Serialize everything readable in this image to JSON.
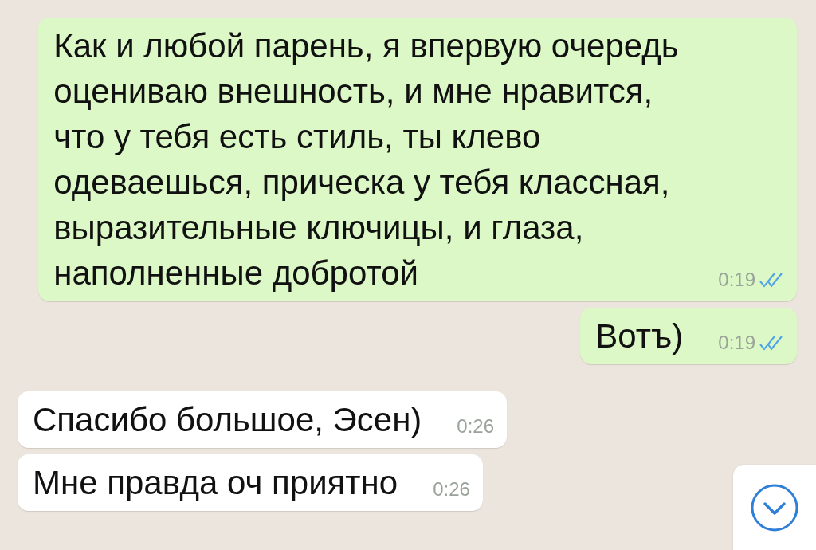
{
  "messages": [
    {
      "outgoing": true,
      "text": "Как и любой парень, я впервую очередь оцениваю внешность, и мне нравится, что у тебя есть стиль, ты клево одеваешься, прическа у тебя классная, выразительные ключицы, и глаза, наполненные добротой",
      "time": "0:19",
      "read": true
    },
    {
      "outgoing": true,
      "text": "Вотъ)",
      "time": "0:19",
      "read": true
    },
    {
      "outgoing": false,
      "text": "Спасибо большое, Эсен)",
      "time": "0:26"
    },
    {
      "outgoing": false,
      "text": "Мне правда оч приятно",
      "time": "0:26"
    }
  ]
}
